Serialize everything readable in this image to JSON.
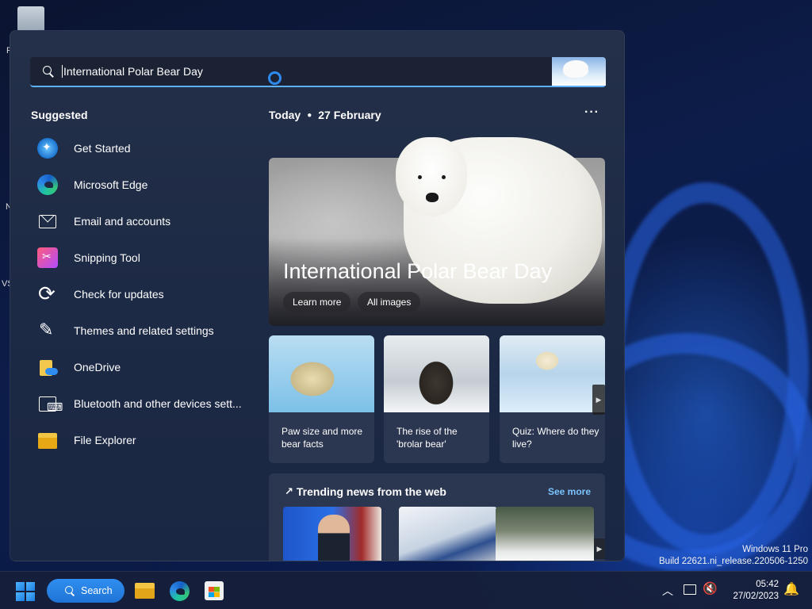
{
  "desktop": {
    "fragments": [
      "R",
      "N",
      "VS"
    ],
    "watermark": {
      "line1": "Windows 11 Pro",
      "line2": "Build 22621.ni_release.220506-1250"
    }
  },
  "search": {
    "query": "International Polar Bear Day",
    "highlight_icon": "polar-bear-icon"
  },
  "suggested": {
    "title": "Suggested",
    "items": [
      {
        "label": "Get Started",
        "icon": "get-started-icon"
      },
      {
        "label": "Microsoft Edge",
        "icon": "edge-icon"
      },
      {
        "label": "Email and accounts",
        "icon": "mail-icon"
      },
      {
        "label": "Snipping Tool",
        "icon": "snipping-tool-icon"
      },
      {
        "label": "Check for updates",
        "icon": "refresh-icon"
      },
      {
        "label": "Themes and related settings",
        "icon": "brush-icon"
      },
      {
        "label": "OneDrive",
        "icon": "onedrive-icon"
      },
      {
        "label": "Bluetooth and other devices sett...",
        "icon": "devices-icon"
      },
      {
        "label": "File Explorer",
        "icon": "folder-icon"
      }
    ]
  },
  "today": {
    "label": "Today",
    "date": "27 February",
    "more": "···"
  },
  "hero": {
    "title": "International Polar Bear Day",
    "buttons": [
      "Learn more",
      "All images"
    ]
  },
  "cards": [
    {
      "text": "Paw size and more bear facts"
    },
    {
      "text": "The rise of the 'brolar bear'"
    },
    {
      "text": "Quiz: Where do they live?"
    }
  ],
  "trending": {
    "title": "Trending news from the web",
    "see_more": "See more"
  },
  "taskbar": {
    "search_label": "Search",
    "apps": [
      "File Explorer",
      "Microsoft Edge",
      "Microsoft Store"
    ],
    "time": "05:42",
    "date": "27/02/2023"
  },
  "colors": {
    "accent": "#2f8ef0",
    "link": "#7cc4ff",
    "flyout_bg": "#1d2a45",
    "taskbar_bg": "#16203a"
  }
}
